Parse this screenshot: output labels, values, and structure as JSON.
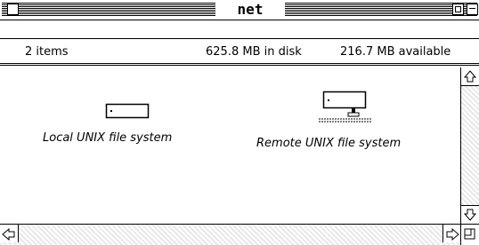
{
  "window": {
    "title": "net"
  },
  "header": {
    "item_count": "2 items",
    "disk_usage": "625.8 MB in disk",
    "available": "216.7 MB available"
  },
  "files": [
    {
      "label": "Local UNIX file system",
      "icon": "drive-icon"
    },
    {
      "label": "Remote UNIX file system",
      "icon": "network-drive-icon"
    }
  ],
  "icons": {
    "close": "close-box-icon",
    "zoom": "zoom-box-icon",
    "collapse": "collapse-box-icon",
    "scroll_up": "up-arrow-icon",
    "scroll_down": "down-arrow-icon",
    "scroll_left": "left-arrow-icon",
    "scroll_right": "right-arrow-icon",
    "grow": "grow-box-icon"
  }
}
